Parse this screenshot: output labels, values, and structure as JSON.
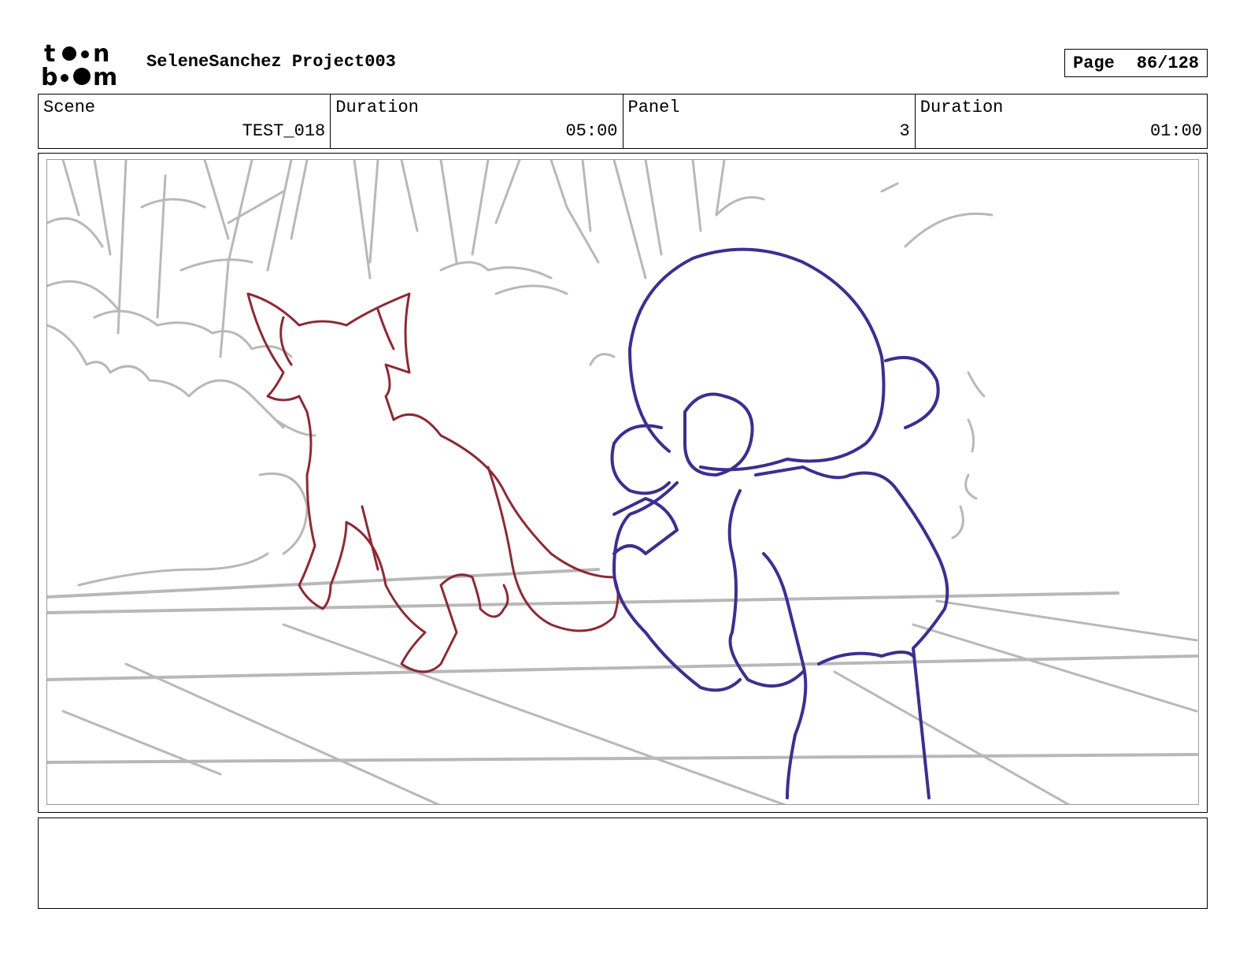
{
  "header": {
    "logo_top": "toon",
    "logo_bottom": "boom",
    "project_title": "SeleneSanchez Project003",
    "page_label": "Page",
    "page_number": "86/128"
  },
  "info": {
    "scene_label": "Scene",
    "scene_value": "TEST_018",
    "scene_duration_label": "Duration",
    "scene_duration_value": "05:00",
    "panel_label": "Panel",
    "panel_value": "3",
    "panel_duration_label": "Duration",
    "panel_duration_value": "01:00"
  },
  "drawing": {
    "background_color": "#b8b8b8",
    "fox_color": "#8c2a36",
    "character_color": "#3b2f8f"
  },
  "notes": {
    "text": ""
  }
}
